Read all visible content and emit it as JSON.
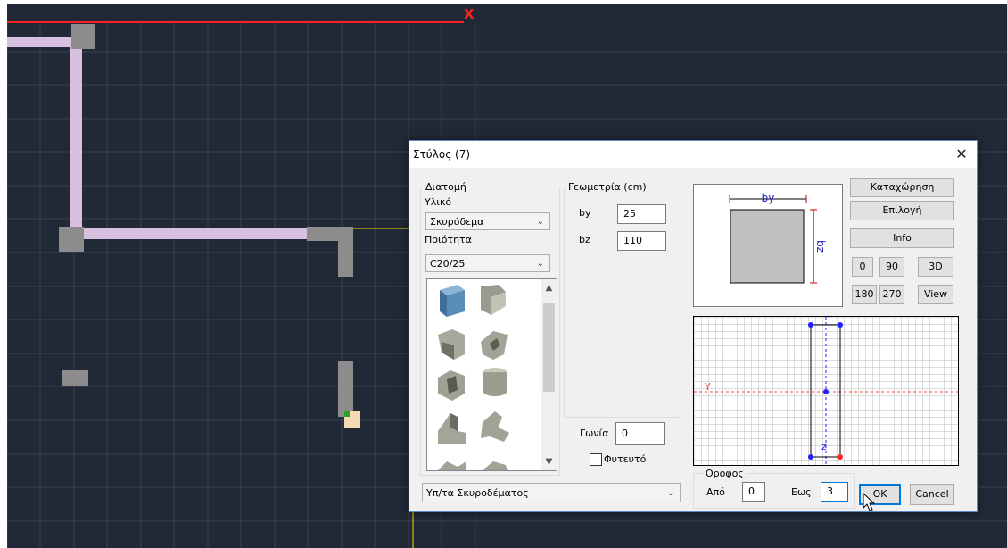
{
  "cad": {
    "axis_x_label": "X"
  },
  "dialog": {
    "title": "Στύλος (7)",
    "close_glyph": "✕",
    "section": {
      "label": "Διατομή",
      "material_label": "Υλικό",
      "material_value": "Σκυρόδεμα",
      "quality_label": "Ποιότητα",
      "quality_value": "C20/25"
    },
    "geometry": {
      "label": "Γεωμετρία (cm)",
      "by_label": "by",
      "by_value": "25",
      "bz_label": "bz",
      "bz_value": "110"
    },
    "angle": {
      "label": "Γωνία",
      "value": "0"
    },
    "planted": {
      "label": "Φυτευτό",
      "checked": false
    },
    "material_type_value": "Υπ/τα Σκυροδέματος",
    "preview": {
      "by_label": "by",
      "bz_label": "bz"
    },
    "grid": {
      "y_label": "Y",
      "z_label": "z"
    },
    "buttons": {
      "register": "Καταχώρηση",
      "select": "Επιλογή",
      "info": "Info",
      "rot0": "0",
      "rot90": "90",
      "view3d": "3D",
      "rot180": "180",
      "rot270": "270",
      "view": "View",
      "ok": "OK",
      "cancel": "Cancel"
    },
    "floor": {
      "label": "Οροφος",
      "from_label": "Από",
      "from_value": "0",
      "to_label": "Εως",
      "to_value": "3"
    }
  }
}
